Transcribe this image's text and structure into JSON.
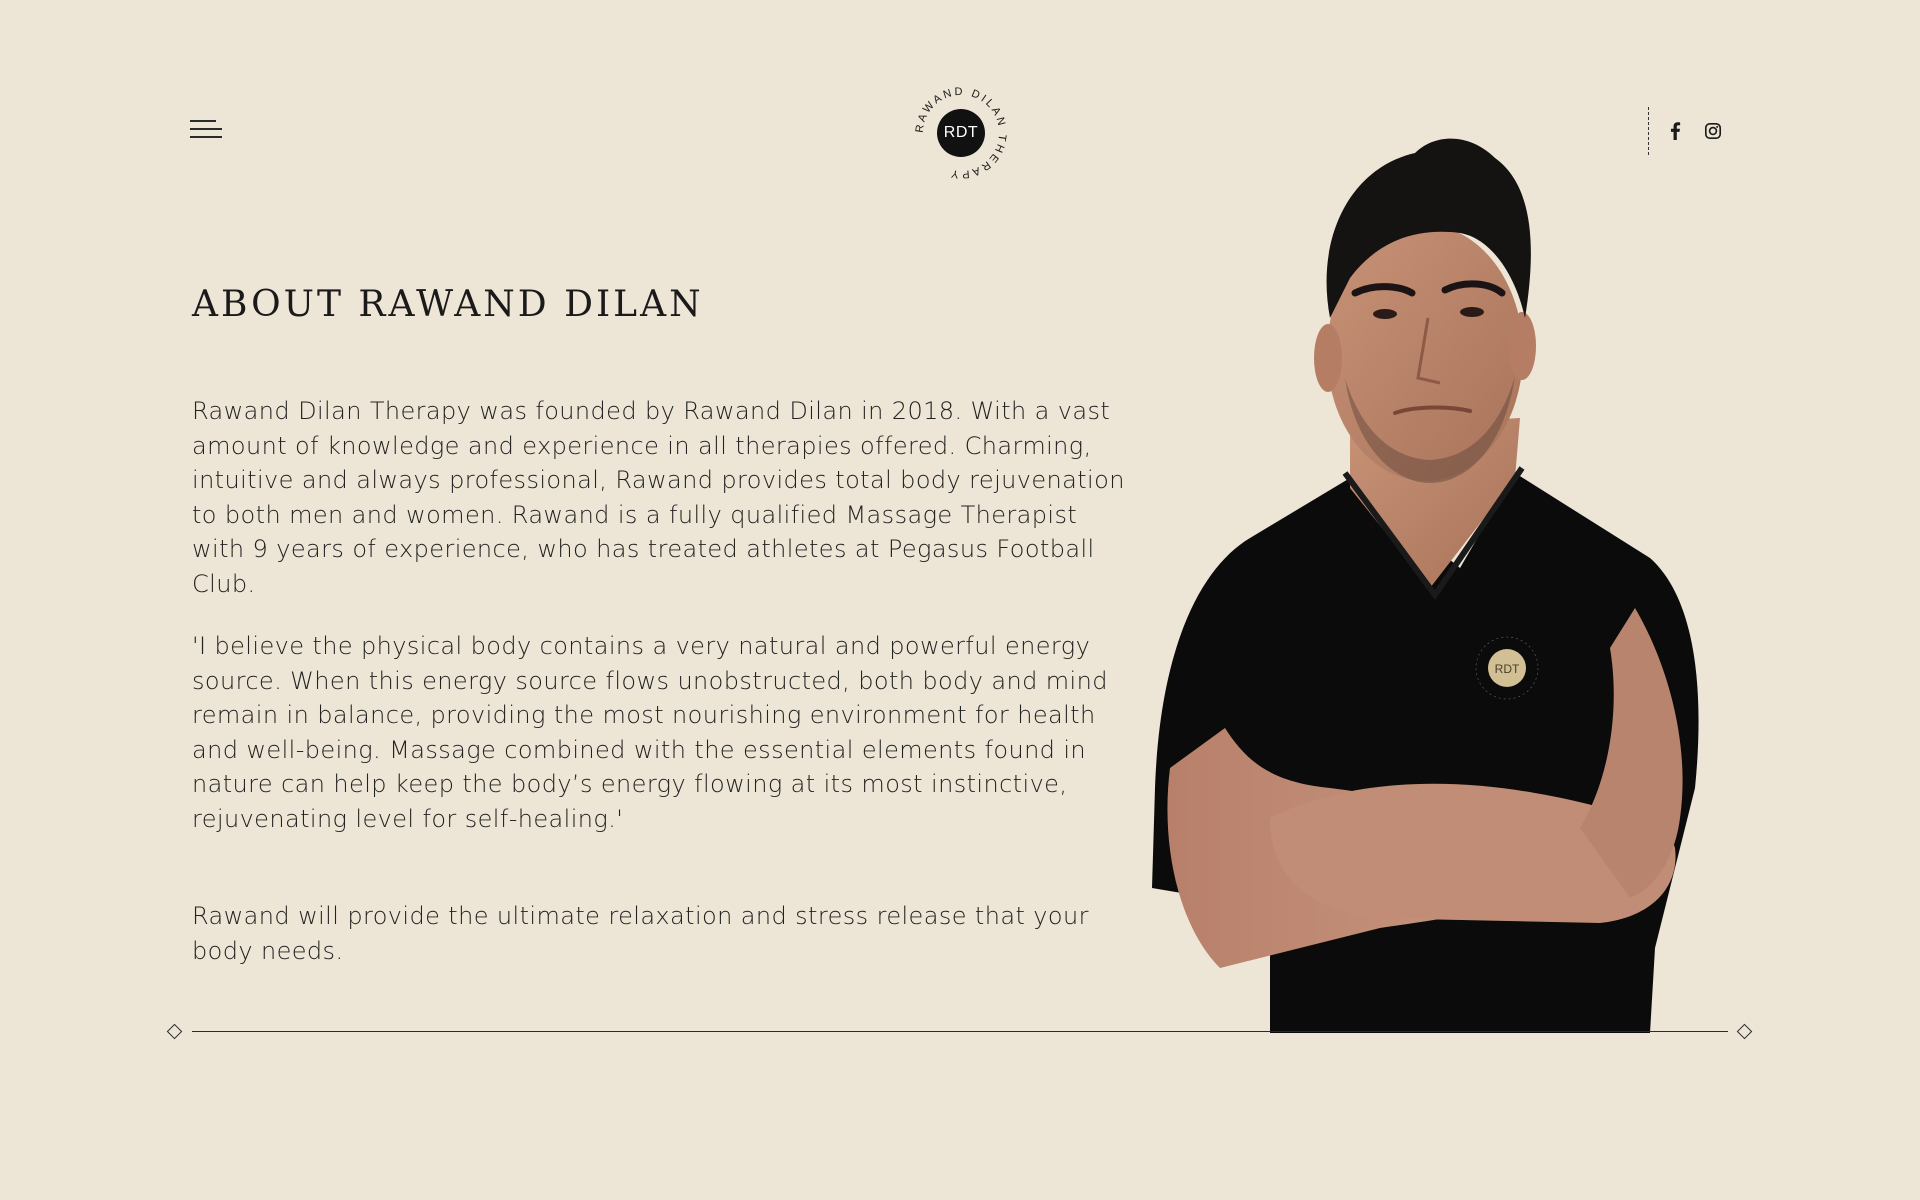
{
  "header": {
    "menu_icon": "hamburger-menu-icon",
    "logo": {
      "monogram": "RDT",
      "ring_text": "RAWAND DILAN THERAPY"
    },
    "social": [
      {
        "name": "facebook",
        "icon": "facebook-icon"
      },
      {
        "name": "instagram",
        "icon": "instagram-icon"
      }
    ]
  },
  "about": {
    "title": "ABOUT RAWAND DILAN",
    "paragraphs": [
      "Rawand Dilan Therapy was founded by Rawand Dilan in 2018. With a vast amount of knowledge and experience in all therapies offered. Charming, intuitive and always professional, Rawand provides total body rejuvenation to both men and women. Rawand is a fully qualified Massage Therapist with 9 years of experience, who has treated athletes at Pegasus Football Club.",
      "'I believe the physical body contains a very natural and powerful energy source. When this energy source flows unobstructed, both body and mind remain in balance, providing the most nourishing environment for health and well-being. Massage combined with the essential elements found in nature can help keep the body’s energy flowing at its most instinctive, rejuvenating level for self-healing.'",
      "Rawand will provide the ultimate relaxation and stress release that your body needs."
    ]
  },
  "portrait": {
    "shirt_logo_monogram": "RDT",
    "shirt_logo_ring_text": "RAWAND DILAN THERAPY"
  },
  "colors": {
    "background": "#ede5d5",
    "text": "#1f1f1f",
    "logo_dark": "#111111",
    "shirt_logo_gold": "#d2bf93"
  }
}
